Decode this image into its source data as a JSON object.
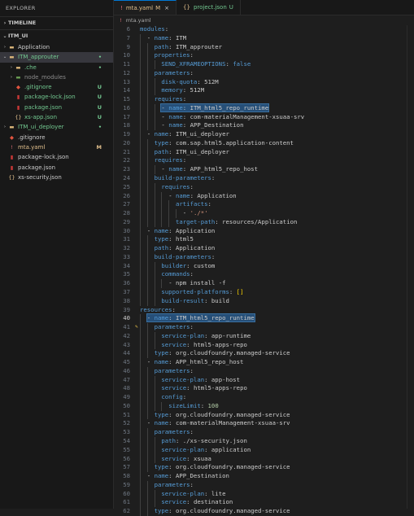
{
  "explorer": {
    "title": "EXPLORER",
    "timeline_label": "TIMELINE",
    "root_label": "ITM_UI",
    "items": [
      {
        "name": "tree-item-application",
        "label": "Application",
        "indent": 1,
        "twisty": "›",
        "icon": "▬",
        "icon_color": "#dcb67a",
        "badge": "",
        "label_color": "#cccccc",
        "badge_color": "",
        "selected": false
      },
      {
        "name": "tree-item-itm-approuter",
        "label": "ITM_approuter",
        "indent": 1,
        "twisty": "⌄",
        "icon": "▬",
        "icon_color": "#dcb67a",
        "badge": "•",
        "label_color": "#73c991",
        "badge_color": "#73c991",
        "selected": true
      },
      {
        "name": "tree-item-che",
        "label": ".che",
        "indent": 2,
        "twisty": "›",
        "icon": "▬",
        "icon_color": "#dcb67a",
        "badge": "•",
        "label_color": "#73c991",
        "badge_color": "#73c991",
        "selected": false
      },
      {
        "name": "tree-item-node-modules",
        "label": "node_modules",
        "indent": 2,
        "twisty": "›",
        "icon": "▬",
        "icon_color": "#6b9e55",
        "badge": "",
        "label_color": "#8c8c8c",
        "badge_color": "",
        "selected": false
      },
      {
        "name": "tree-item-gitignore-approuter",
        "label": ".gitignore",
        "indent": 2,
        "twisty": "",
        "icon": "◆",
        "icon_color": "#e2543f",
        "badge": "U",
        "label_color": "#73c991",
        "badge_color": "#73c991",
        "selected": false
      },
      {
        "name": "tree-item-package-lock-approuter",
        "label": "package-lock.json",
        "indent": 2,
        "twisty": "",
        "icon": "▮",
        "icon_color": "#cb3837",
        "badge": "U",
        "label_color": "#73c991",
        "badge_color": "#73c991",
        "selected": false
      },
      {
        "name": "tree-item-package-json-approuter",
        "label": "package.json",
        "indent": 2,
        "twisty": "",
        "icon": "▮",
        "icon_color": "#cb3837",
        "badge": "U",
        "label_color": "#73c991",
        "badge_color": "#73c991",
        "selected": false
      },
      {
        "name": "tree-item-xs-app-json",
        "label": "xs-app.json",
        "indent": 2,
        "twisty": "",
        "icon": "{}",
        "icon_color": "#e2c08d",
        "badge": "U",
        "label_color": "#73c991",
        "badge_color": "#73c991",
        "selected": false
      },
      {
        "name": "tree-item-itm-ui-deployer",
        "label": "ITM_ui_deployer",
        "indent": 1,
        "twisty": "›",
        "icon": "▬",
        "icon_color": "#dcb67a",
        "badge": "•",
        "label_color": "#73c991",
        "badge_color": "#73c991",
        "selected": false
      },
      {
        "name": "tree-item-gitignore",
        "label": ".gitignore",
        "indent": 1,
        "twisty": "",
        "icon": "◆",
        "icon_color": "#e2543f",
        "badge": "",
        "label_color": "#cccccc",
        "badge_color": "",
        "selected": false
      },
      {
        "name": "tree-item-mta-yaml",
        "label": "mta.yaml",
        "indent": 1,
        "twisty": "",
        "icon": "!",
        "icon_color": "#e06c75",
        "badge": "M",
        "label_color": "#e2c08d",
        "badge_color": "#e2c08d",
        "selected": false
      },
      {
        "name": "tree-item-package-lock",
        "label": "package-lock.json",
        "indent": 1,
        "twisty": "",
        "icon": "▮",
        "icon_color": "#cb3837",
        "badge": "",
        "label_color": "#cccccc",
        "badge_color": "",
        "selected": false
      },
      {
        "name": "tree-item-package-json",
        "label": "package.json",
        "indent": 1,
        "twisty": "",
        "icon": "▮",
        "icon_color": "#cb3837",
        "badge": "",
        "label_color": "#cccccc",
        "badge_color": "",
        "selected": false
      },
      {
        "name": "tree-item-xs-security",
        "label": "xs-security.json",
        "indent": 1,
        "twisty": "",
        "icon": "{}",
        "icon_color": "#e2c08d",
        "badge": "",
        "label_color": "#cccccc",
        "badge_color": "",
        "selected": false
      }
    ]
  },
  "tabs": [
    {
      "name": "tab-mta-yaml",
      "label": "mta.yaml",
      "status": "M",
      "icon": "!",
      "active": true,
      "close": "×"
    },
    {
      "name": "tab-project-json",
      "label": "project.json",
      "status": "U",
      "icon": "{}",
      "active": false,
      "close": ""
    }
  ],
  "breadcrumb": {
    "icon": "!",
    "label": "mta.yaml"
  },
  "editor": {
    "current_line": 40,
    "lines": [
      {
        "n": 6,
        "i": 0,
        "k": "modules",
        "s": ":",
        "v": "",
        "t": ""
      },
      {
        "n": 7,
        "i": 2,
        "d": "- ",
        "k": "name",
        "s": ": ",
        "v": "ITM",
        "t": "p"
      },
      {
        "n": 9,
        "i": 4,
        "k": "path",
        "s": ": ",
        "v": "ITM_approuter",
        "t": "p"
      },
      {
        "n": 10,
        "i": 4,
        "k": "properties",
        "s": ":",
        "v": "",
        "t": ""
      },
      {
        "n": 11,
        "i": 6,
        "k": "SEND_XFRAMEOPTIONS",
        "s": ": ",
        "v": "false",
        "t": "k"
      },
      {
        "n": 12,
        "i": 4,
        "k": "parameters",
        "s": ":",
        "v": "",
        "t": ""
      },
      {
        "n": 13,
        "i": 6,
        "k": "disk-quota",
        "s": ": ",
        "v": "512M",
        "t": "p"
      },
      {
        "n": 14,
        "i": 6,
        "k": "memory",
        "s": ": ",
        "v": "512M",
        "t": "p"
      },
      {
        "n": 15,
        "i": 4,
        "k": "requires",
        "s": ":",
        "v": "",
        "t": ""
      },
      {
        "n": 16,
        "i": 6,
        "d": "- ",
        "k": "name",
        "s": ": ",
        "v": "ITM_html5_repo_runtime",
        "t": "p",
        "hl": true
      },
      {
        "n": 17,
        "i": 6,
        "d": "- ",
        "k": "name",
        "s": ": ",
        "v": "com-materialManagement-xsuaa-srv",
        "t": "p"
      },
      {
        "n": 18,
        "i": 6,
        "d": "- ",
        "k": "name",
        "s": ": ",
        "v": "APP_Destination",
        "t": "p"
      },
      {
        "n": 19,
        "i": 2,
        "d": "- ",
        "k": "name",
        "s": ": ",
        "v": "ITM_ui_deployer",
        "t": "p"
      },
      {
        "n": 20,
        "i": 4,
        "k": "type",
        "s": ": ",
        "v": "com.sap.html5.application-content",
        "t": "p"
      },
      {
        "n": 21,
        "i": 4,
        "k": "path",
        "s": ": ",
        "v": "ITM_ui_deployer",
        "t": "p"
      },
      {
        "n": 22,
        "i": 4,
        "k": "requires",
        "s": ":",
        "v": "",
        "t": ""
      },
      {
        "n": 23,
        "i": 6,
        "d": "- ",
        "k": "name",
        "s": ": ",
        "v": "APP_html5_repo_host",
        "t": "p"
      },
      {
        "n": 24,
        "i": 4,
        "k": "build-parameters",
        "s": ":",
        "v": "",
        "t": ""
      },
      {
        "n": 25,
        "i": 6,
        "k": "requires",
        "s": ":",
        "v": "",
        "t": ""
      },
      {
        "n": 26,
        "i": 8,
        "d": "- ",
        "k": "name",
        "s": ": ",
        "v": "Application",
        "t": "p"
      },
      {
        "n": 27,
        "i": 10,
        "k": "artifacts",
        "s": ":",
        "v": "",
        "t": ""
      },
      {
        "n": 28,
        "i": 12,
        "d": "- ",
        "k": "",
        "s": "",
        "v": "'./*'",
        "t": "v"
      },
      {
        "n": 29,
        "i": 10,
        "k": "target-path",
        "s": ": ",
        "v": "resources/Application",
        "t": "p"
      },
      {
        "n": 30,
        "i": 2,
        "d": "- ",
        "k": "name",
        "s": ": ",
        "v": "Application",
        "t": "p"
      },
      {
        "n": 31,
        "i": 4,
        "k": "type",
        "s": ": ",
        "v": "html5",
        "t": "p"
      },
      {
        "n": 32,
        "i": 4,
        "k": "path",
        "s": ": ",
        "v": "Application",
        "t": "p"
      },
      {
        "n": 33,
        "i": 4,
        "k": "build-parameters",
        "s": ":",
        "v": "",
        "t": ""
      },
      {
        "n": 34,
        "i": 6,
        "k": "builder",
        "s": ": ",
        "v": "custom",
        "t": "p"
      },
      {
        "n": 35,
        "i": 6,
        "k": "commands",
        "s": ":",
        "v": "",
        "t": ""
      },
      {
        "n": 36,
        "i": 8,
        "d": "- ",
        "k": "",
        "s": "",
        "v": "npm install -f",
        "t": "p"
      },
      {
        "n": 37,
        "i": 6,
        "k": "supported-platforms",
        "s": ": ",
        "v": "[]",
        "t": "y"
      },
      {
        "n": 38,
        "i": 6,
        "k": "build-result",
        "s": ": ",
        "v": "build",
        "t": "p"
      },
      {
        "n": 39,
        "i": 0,
        "k": "resources",
        "s": ":",
        "v": "",
        "t": ""
      },
      {
        "n": 40,
        "i": 2,
        "d": "- ",
        "k": "name",
        "s": ": ",
        "v": "ITM_html5_repo_runtime",
        "t": "p",
        "hl": true,
        "cur": true
      },
      {
        "n": 41,
        "i": 4,
        "k": "parameters",
        "s": ":",
        "v": "",
        "t": "",
        "bulb": true
      },
      {
        "n": 42,
        "i": 6,
        "k": "service-plan",
        "s": ": ",
        "v": "app-runtime",
        "t": "p"
      },
      {
        "n": 43,
        "i": 6,
        "k": "service",
        "s": ": ",
        "v": "html5-apps-repo",
        "t": "p"
      },
      {
        "n": 44,
        "i": 4,
        "k": "type",
        "s": ": ",
        "v": "org.cloudfoundry.managed-service",
        "t": "p"
      },
      {
        "n": 45,
        "i": 2,
        "d": "- ",
        "k": "name",
        "s": ": ",
        "v": "APP_html5_repo_host",
        "t": "p"
      },
      {
        "n": 46,
        "i": 4,
        "k": "parameters",
        "s": ":",
        "v": "",
        "t": ""
      },
      {
        "n": 47,
        "i": 6,
        "k": "service-plan",
        "s": ": ",
        "v": "app-host",
        "t": "p"
      },
      {
        "n": 48,
        "i": 6,
        "k": "service",
        "s": ": ",
        "v": "html5-apps-repo",
        "t": "p"
      },
      {
        "n": 49,
        "i": 6,
        "k": "config",
        "s": ":",
        "v": "",
        "t": ""
      },
      {
        "n": 50,
        "i": 8,
        "k": "sizeLimit",
        "s": ": ",
        "v": "100",
        "t": "n"
      },
      {
        "n": 51,
        "i": 4,
        "k": "type",
        "s": ": ",
        "v": "org.cloudfoundry.managed-service",
        "t": "p"
      },
      {
        "n": 52,
        "i": 2,
        "d": "- ",
        "k": "name",
        "s": ": ",
        "v": "com-materialManagement-xsuaa-srv",
        "t": "p"
      },
      {
        "n": 53,
        "i": 4,
        "k": "parameters",
        "s": ":",
        "v": "",
        "t": ""
      },
      {
        "n": 54,
        "i": 6,
        "k": "path",
        "s": ": ",
        "v": "./xs-security.json",
        "t": "p"
      },
      {
        "n": 55,
        "i": 6,
        "k": "service-plan",
        "s": ": ",
        "v": "application",
        "t": "p"
      },
      {
        "n": 56,
        "i": 6,
        "k": "service",
        "s": ": ",
        "v": "xsuaa",
        "t": "p"
      },
      {
        "n": 57,
        "i": 4,
        "k": "type",
        "s": ": ",
        "v": "org.cloudfoundry.managed-service",
        "t": "p"
      },
      {
        "n": 58,
        "i": 2,
        "d": "- ",
        "k": "name",
        "s": ": ",
        "v": "APP_Destination",
        "t": "p"
      },
      {
        "n": 59,
        "i": 4,
        "k": "parameters",
        "s": ":",
        "v": "",
        "t": ""
      },
      {
        "n": 60,
        "i": 6,
        "k": "service-plan",
        "s": ": ",
        "v": "lite",
        "t": "p"
      },
      {
        "n": 61,
        "i": 6,
        "k": "service",
        "s": ": ",
        "v": "destination",
        "t": "p"
      },
      {
        "n": 62,
        "i": 4,
        "k": "type",
        "s": ": ",
        "v": "org.cloudfoundry.managed-service",
        "t": "p"
      }
    ]
  }
}
